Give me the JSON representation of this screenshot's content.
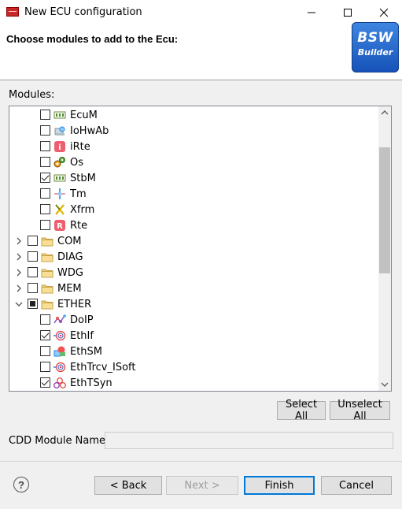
{
  "window": {
    "title": "New ECU configuration",
    "controls": [
      "minimize-icon",
      "maximize-icon",
      "close-icon"
    ]
  },
  "header": {
    "heading": "Choose modules to add to the Ecu:",
    "logo": {
      "line1": "BSW",
      "line2": "Builder"
    }
  },
  "modules_label": "Modules:",
  "tree": {
    "rows": [
      {
        "label": "EcuM",
        "level": 1,
        "checked": false,
        "icon": "module-icon"
      },
      {
        "label": "IoHwAb",
        "level": 1,
        "checked": false,
        "icon": "iohwab-icon"
      },
      {
        "label": "iRte",
        "level": 1,
        "checked": false,
        "icon": "irte-icon"
      },
      {
        "label": "Os",
        "level": 1,
        "checked": false,
        "icon": "os-gears-icon"
      },
      {
        "label": "StbM",
        "level": 1,
        "checked": true,
        "icon": "module-icon"
      },
      {
        "label": "Tm",
        "level": 1,
        "checked": false,
        "icon": "tm-icon"
      },
      {
        "label": "Xfrm",
        "level": 1,
        "checked": false,
        "icon": "xfrm-icon"
      },
      {
        "label": "Rte",
        "level": 1,
        "checked": false,
        "icon": "rte-icon"
      },
      {
        "label": "COM",
        "level": 0,
        "checked": false,
        "icon": "folder-icon",
        "expanded": false
      },
      {
        "label": "DIAG",
        "level": 0,
        "checked": false,
        "icon": "folder-icon",
        "expanded": false
      },
      {
        "label": "WDG",
        "level": 0,
        "checked": false,
        "icon": "folder-icon",
        "expanded": false
      },
      {
        "label": "MEM",
        "level": 0,
        "checked": false,
        "icon": "folder-icon",
        "expanded": false
      },
      {
        "label": "ETHER",
        "level": 0,
        "checked": "partial",
        "icon": "folder-icon",
        "expanded": true
      },
      {
        "label": "DoIP",
        "level": 1,
        "checked": false,
        "icon": "doip-icon"
      },
      {
        "label": "EthIf",
        "level": 1,
        "checked": true,
        "icon": "eth-icon"
      },
      {
        "label": "EthSM",
        "level": 1,
        "checked": false,
        "icon": "ethsm-icon"
      },
      {
        "label": "EthTrcv_ISoft",
        "level": 1,
        "checked": false,
        "icon": "eth-icon"
      },
      {
        "label": "EthTSyn",
        "level": 1,
        "checked": true,
        "icon": "ethtsyn-icon"
      }
    ]
  },
  "buttons": {
    "select_all": "Select All",
    "unselect_all": "Unselect All",
    "back": "< Back",
    "next": "Next >",
    "finish": "Finish",
    "cancel": "Cancel"
  },
  "cdd": {
    "label": "CDD Module Name:",
    "value": ""
  },
  "colors": {
    "accent": "#0078d7",
    "logo_blue": "#1f5fc7",
    "folder": "#e8c468"
  }
}
